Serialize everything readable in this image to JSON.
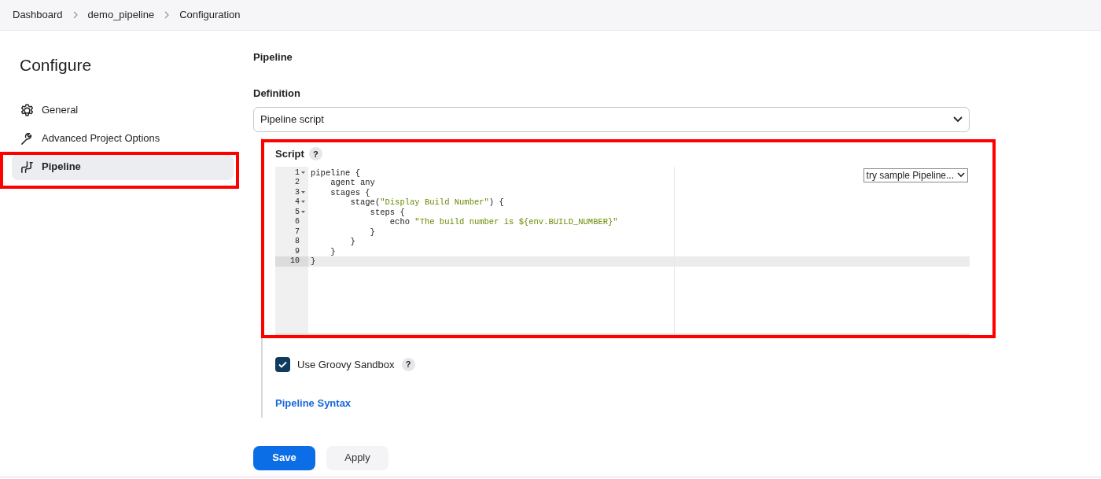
{
  "breadcrumbs": [
    "Dashboard",
    "demo_pipeline",
    "Configuration"
  ],
  "sidebar": {
    "title": "Configure",
    "items": [
      {
        "label": "General",
        "selected": false,
        "highlighted": false
      },
      {
        "label": "Advanced Project Options",
        "selected": false,
        "highlighted": false
      },
      {
        "label": "Pipeline",
        "selected": true,
        "highlighted": true
      }
    ]
  },
  "section_title": "Pipeline",
  "definition": {
    "label": "Definition",
    "value": "Pipeline script"
  },
  "script": {
    "label": "Script",
    "help": "?",
    "highlighted": true,
    "sample_select": "try sample Pipeline...",
    "lines": [
      {
        "number": "1",
        "foldable": true,
        "active": false,
        "segments": [
          {
            "kind": "plain",
            "text": "pipeline {"
          }
        ]
      },
      {
        "number": "2",
        "foldable": false,
        "active": false,
        "segments": [
          {
            "kind": "plain",
            "text": "    agent any"
          }
        ]
      },
      {
        "number": "3",
        "foldable": true,
        "active": false,
        "segments": [
          {
            "kind": "plain",
            "text": "    stages {"
          }
        ]
      },
      {
        "number": "4",
        "foldable": true,
        "active": false,
        "segments": [
          {
            "kind": "plain",
            "text": "        stage("
          },
          {
            "kind": "string",
            "text": "\"Display Build Number\""
          },
          {
            "kind": "plain",
            "text": ") {"
          }
        ]
      },
      {
        "number": "5",
        "foldable": true,
        "active": false,
        "segments": [
          {
            "kind": "plain",
            "text": "            steps {"
          }
        ]
      },
      {
        "number": "6",
        "foldable": false,
        "active": false,
        "segments": [
          {
            "kind": "plain",
            "text": "                echo "
          },
          {
            "kind": "string",
            "text": "\"The build number is ${env.BUILD_NUMBER}\""
          }
        ]
      },
      {
        "number": "7",
        "foldable": false,
        "active": false,
        "segments": [
          {
            "kind": "plain",
            "text": "            }"
          }
        ]
      },
      {
        "number": "8",
        "foldable": false,
        "active": false,
        "segments": [
          {
            "kind": "plain",
            "text": "        }"
          }
        ]
      },
      {
        "number": "9",
        "foldable": false,
        "active": false,
        "segments": [
          {
            "kind": "plain",
            "text": "    }"
          }
        ]
      },
      {
        "number": "10",
        "foldable": false,
        "active": true,
        "segments": [
          {
            "kind": "plain",
            "text": "}"
          }
        ]
      }
    ]
  },
  "sandbox": {
    "label": "Use Groovy Sandbox",
    "checked": true,
    "help": "?"
  },
  "syntax_link": "Pipeline Syntax",
  "buttons": [
    {
      "label": "Save",
      "kind": "primary"
    },
    {
      "label": "Apply",
      "kind": "secondary"
    }
  ]
}
